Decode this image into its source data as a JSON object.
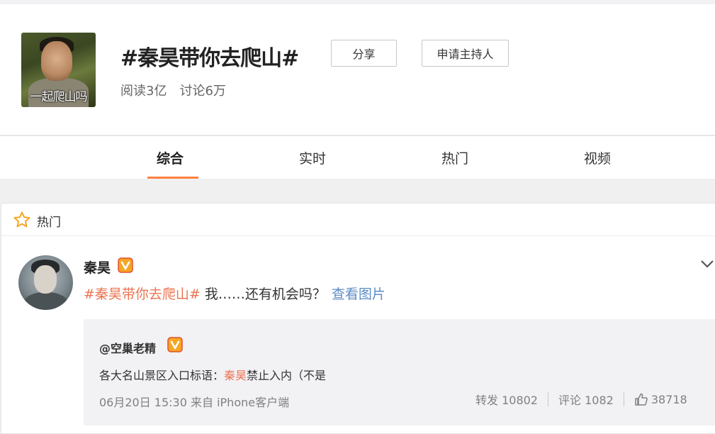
{
  "topic": {
    "title": "#秦昊带你去爬山#",
    "cover_caption": "一起爬山吗",
    "read_count": "阅读3亿",
    "discuss_count": "讨论6万",
    "share_label": "分享",
    "host_label": "申请主持人"
  },
  "tabs": [
    {
      "label": "综合",
      "active": true
    },
    {
      "label": "实时",
      "active": false
    },
    {
      "label": "热门",
      "active": false
    },
    {
      "label": "视频",
      "active": false
    }
  ],
  "feed": {
    "section_label": "热门",
    "post": {
      "author": "秦昊",
      "hashtag": "#秦昊带你去爬山#",
      "text": " 我……还有机会吗？",
      "view_pictures": "查看图片",
      "repost": {
        "author": "@空巢老精",
        "text_prefix": "各大名山景区入口标语：",
        "text_mention": "秦昊",
        "text_suffix": "禁止入内（不是",
        "meta": "06月20日 15:30 来自 iPhone客户端",
        "reposts": "转发 10802",
        "comments": "评论 1082",
        "likes": "38718"
      }
    }
  },
  "colors": {
    "accent_orange": "#ff8140",
    "hashtag": "#eb7350",
    "link_blue": "#5d8bc4",
    "verified_badge": "#f5a623"
  },
  "icons": [
    "star-icon",
    "verified-badge-icon",
    "chevron-down-icon",
    "like-icon"
  ]
}
